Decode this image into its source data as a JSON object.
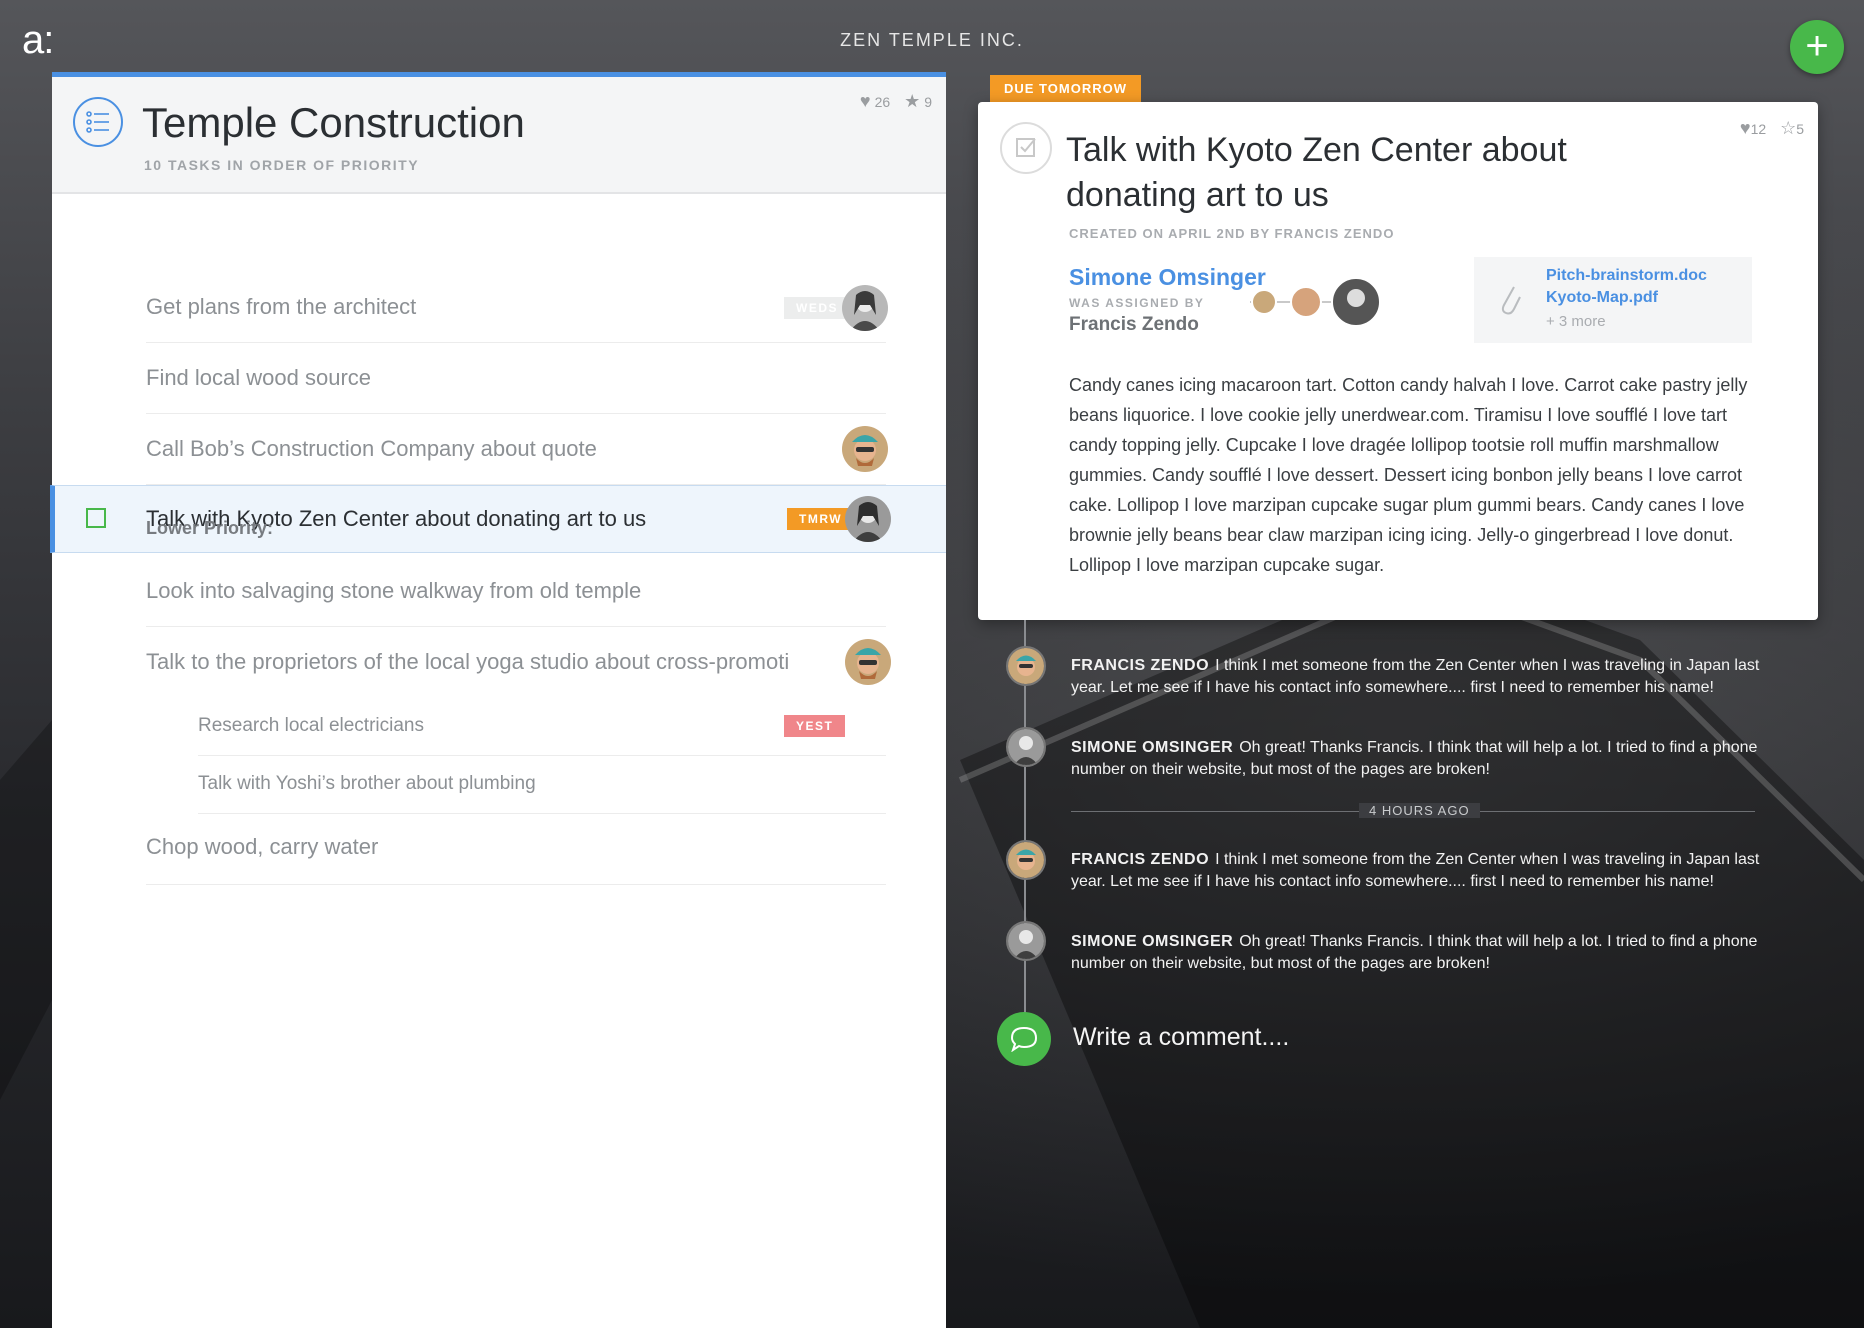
{
  "app": {
    "logo": "a:",
    "company": "ZEN TEMPLE INC.",
    "add_label": "+"
  },
  "project": {
    "title": "Temple Construction",
    "subtitle": "10 TASKS IN ORDER OF PRIORITY",
    "likes": "26",
    "stars": "9"
  },
  "tasks": [
    {
      "label": "Get plans from the architect",
      "badge": "WEDS"
    },
    {
      "label": "Find local wood source"
    },
    {
      "label": "Call Bob’s Construction Company about quote"
    },
    {
      "label": "Talk with Kyoto Zen Center about donating art to us",
      "badge": "TMRW"
    },
    {
      "label": "Look into salvaging stone walkway from old temple"
    },
    {
      "label": "Talk to the proprietors of the local yoga studio about cross-promoti"
    },
    {
      "label": "Research local electricians",
      "badge": "YEST"
    },
    {
      "label": "Talk with Yoshi’s brother about plumbing"
    },
    {
      "label": "Chop wood, carry water"
    }
  ],
  "section_label": "Lower Priority:",
  "detail": {
    "due_label": "DUE TOMORROW",
    "title": "Talk with Kyoto Zen Center about donating art to us",
    "meta": "CREATED ON APRIL 2ND BY FRANCIS ZENDO",
    "likes": "12",
    "stars": "5",
    "assignee": "Simone Omsinger",
    "assigned_by_label": "WAS ASSIGNED BY",
    "assigned_by": "Francis Zendo",
    "attachments": [
      "Pitch-brainstorm.doc",
      "Kyoto-Map.pdf"
    ],
    "attachments_more": "+ 3 more",
    "body": "Candy canes icing macaroon tart. Cotton candy halvah I love. Carrot cake pastry jelly beans liquorice. I love cookie jelly unerdwear.com. Tiramisu I love soufflé I love tart candy topping jelly. Cupcake I love dragée lollipop tootsie roll muffin marshmallow gummies. Candy soufflé I love dessert. Dessert icing bonbon jelly beans I love carrot cake. Lollipop I love marzipan cupcake sugar plum gummi bears. Candy canes I love brownie jelly beans bear claw marzipan icing icing. Jelly-o gingerbread I love donut. Lollipop I love marzipan cupcake sugar."
  },
  "comments": [
    {
      "author": "FRANCIS ZENDO",
      "text": "I think I met someone from the Zen Center when I was traveling in Japan last year. Let me see if I have his contact info somewhere.... first I need to remember his name!"
    },
    {
      "author": "SIMONE OMSINGER",
      "text": "Oh great! Thanks Francis. I think that will help a lot. I tried to find a phone number on their website, but most of the pages are broken!"
    },
    {
      "author": "FRANCIS ZENDO",
      "text": "I think I met someone from the Zen Center when I was traveling in Japan last year. Let me see if I have his contact info somewhere.... first I need to remember his name!"
    },
    {
      "author": "SIMONE OMSINGER",
      "text": "Oh great! Thanks Francis. I think that will help a lot. I tried to find a phone number on their website, but most of the pages are broken!"
    }
  ],
  "time_separator": "4 HOURS AGO",
  "comment_input": {
    "placeholder": "Write a comment...."
  },
  "colors": {
    "accent": "#4a90e2",
    "green": "#48b84a",
    "orange": "#f39a25",
    "red": "#f0868a"
  }
}
